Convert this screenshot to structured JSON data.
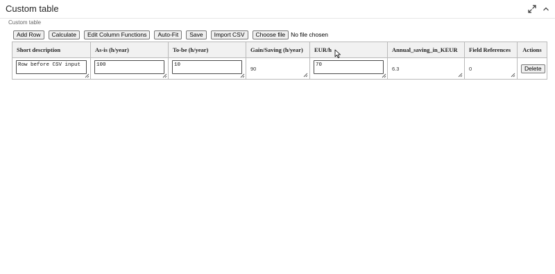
{
  "panel": {
    "title": "Custom table",
    "subtitle": "Custom table",
    "icons": [
      "expand-icon",
      "chevron-up-icon"
    ]
  },
  "toolbar": {
    "add_row": "Add Row",
    "calculate": "Calculate",
    "edit_column_functions": "Edit Column Functions",
    "auto_fit": "Auto-Fit",
    "save": "Save",
    "import_csv": "Import CSV",
    "choose_file": "Choose file",
    "file_status": "No file chosen"
  },
  "table": {
    "headers": {
      "short_description": "Short description",
      "as_is": "As-is (h/year)",
      "to_be": "To-be (h/year)",
      "gain_saving": "Gain/Saving (h/year)",
      "eur_h": "EUR/h",
      "annual_saving": "Annual_saving_in_KEUR",
      "field_references": "Field References",
      "actions": "Actions"
    },
    "rows": [
      {
        "short_description": "Row before CSV input",
        "as_is": "100",
        "to_be": "10",
        "gain_saving": "90",
        "eur_h": "70",
        "annual_saving": "6.3",
        "field_references": "0",
        "delete_label": "Delete"
      }
    ]
  }
}
